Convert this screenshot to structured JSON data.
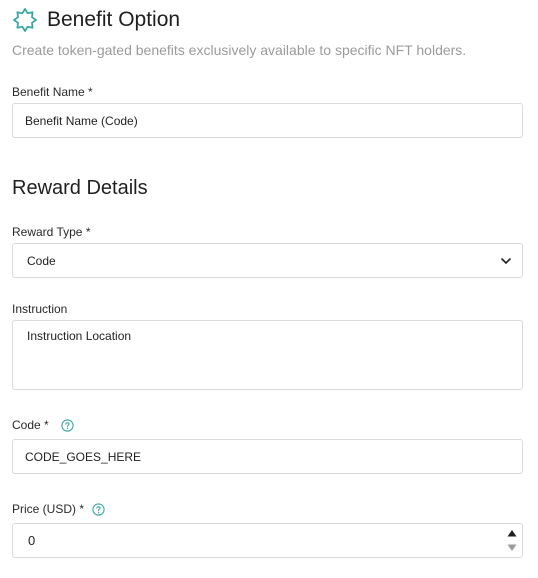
{
  "header": {
    "title": "Benefit Option",
    "subtitle": "Create token-gated benefits exclusively available to specific NFT holders.",
    "icon": "badge-icon",
    "accent_color": "#3aa8a0"
  },
  "benefit_name": {
    "label": "Benefit Name *",
    "value": "Benefit Name (Code)"
  },
  "reward_details": {
    "title": "Reward Details",
    "reward_type": {
      "label": "Reward Type *",
      "selected": "Code",
      "icon": "chevron-down-icon"
    },
    "instruction": {
      "label": "Instruction",
      "placeholder": "Instruction Location"
    },
    "code": {
      "label": "Code *",
      "value": "CODE_GOES_HERE",
      "help_icon": "question-circle-icon"
    },
    "price": {
      "label": "Price (USD) *",
      "value": "0",
      "help_icon": "question-circle-icon"
    }
  },
  "colors": {
    "text": "#1f1f1f",
    "muted": "#9b9b9b",
    "border": "#d9d9d9",
    "help": "#3aa8a0"
  }
}
